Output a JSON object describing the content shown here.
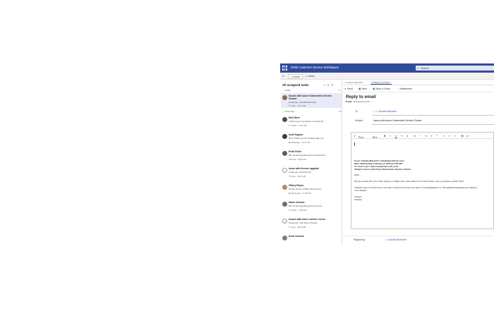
{
  "app": {
    "title": "D365 Customer Service Workspace",
    "search_placeholder": "Search",
    "colors": {
      "brand": "#2f4c9a",
      "selected_item": "#e8ebf7",
      "link": "#3c55b0"
    }
  },
  "session_tabs": [
    {
      "label": "Home",
      "icon": "home-icon"
    },
    {
      "label": "Inbox",
      "icon": "inbox-icon"
    }
  ],
  "task_list": {
    "title": "All assigned tasks",
    "groups": [
      {
        "label": "Today",
        "count": "1"
      },
      {
        "label": "Yesterday",
        "count": "10"
      }
    ],
    "items": [
      {
        "title": "Issues with Azure Kubernetes Service Cluster",
        "line2": "Customer: Claudia Mazzanti",
        "type": "Case",
        "time": "10:41 AM"
      },
      {
        "title": "Emil Berk",
        "line2": "I want to get my license renewed by ...",
        "type": "Twitter",
        "time": "11:32 AM"
      },
      {
        "title": "Audi Kapoor",
        "line2": "Hey! Thank you for chatting with mu...",
        "type": "Whatsapp",
        "time": "11:27 AM"
      },
      {
        "title": "Erika Fuller",
        "line2": "RE: Email regarding Azure Kubernete...",
        "type": "Email",
        "time": "10:02 AM"
      },
      {
        "title": "Issue with license upgrade",
        "line2": "Customer: Vanessa Hu",
        "type": "Case",
        "time": "09:21 AM"
      },
      {
        "title": "Hillary Reyes",
        "line2": "Hi! My name is Hillary Reyes and...",
        "type": "Messenger",
        "time": "07:18 AM"
      },
      {
        "title": "Dawn Carlson",
        "line2": "RE: Email regarding Azure service...",
        "type": "Twitter",
        "time": "11:56 AM"
      },
      {
        "title": "Issues with Azure service errors",
        "line2": "Customer: Yasi Fikret Hudson",
        "type": "Case",
        "time": "08:15 AM"
      },
      {
        "title": "Drew Carlson",
        "line2": "",
        "type": "",
        "time": ""
      }
    ]
  },
  "form_tabs": [
    {
      "label": "Issues with Azu..."
    },
    {
      "label": "Reply to email"
    }
  ],
  "commands": [
    {
      "label": "Send",
      "icon": "send-icon"
    },
    {
      "label": "Save",
      "icon": "save-icon"
    },
    {
      "label": "Save & Close",
      "icon": "save-close-icon"
    },
    {
      "label": "Attachment",
      "icon": "paperclip-icon"
    }
  ],
  "form": {
    "title": "Reply to email",
    "entity": "Email",
    "form_name": "Enhanced email",
    "to_label": "To",
    "to_value": "Claudia Mazzanti",
    "subject_label": "Subject",
    "subject_value": "Issues with Azure Kubernetes Service Cluster",
    "font": "Font",
    "size": "Size",
    "body": {
      "from": "From: Claudia Mazzanti <claudia@outlook.com>",
      "date": "Date: Wednesday, February 8, 2023 at 9:05 AM",
      "to": "To: Ivan Loew <ivan.loew@microsoft.com>",
      "subject": "Subject: Issues with Azure Kubernetes Service Cluster",
      "greeting": "Hello -",
      "p1": "We are seeing this error when trying to configure the route table for our AKS cluster, can you please explain why?",
      "p2a": "\"Default route 0.0.0.0/0 has a next hop of Internet but only next hops of VirtualAppliance or VirtualNetworkGateway are allowed.",
      "p2b": "more details\"",
      "thanks": "Thanks,",
      "sign": "Claudia"
    },
    "regarding_label": "Regarding",
    "regarding_value": "Claudia Mazzanti"
  }
}
